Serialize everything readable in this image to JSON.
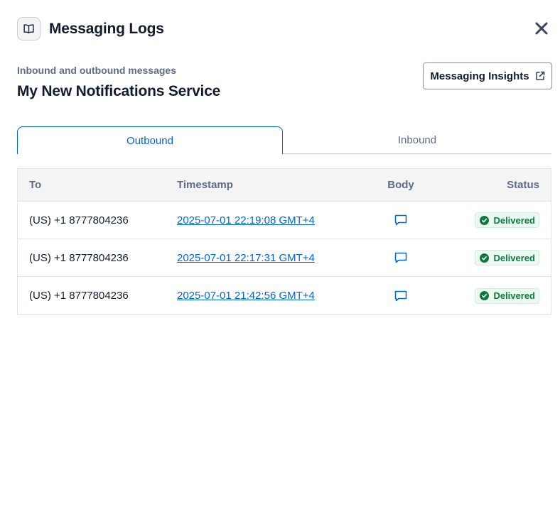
{
  "header": {
    "title": "Messaging Logs",
    "icon": "book-open-icon"
  },
  "close": {
    "icon": "close-icon"
  },
  "subtitle": "Inbound and outbound messages",
  "service_name": "My New Notifications Service",
  "insights_button": {
    "label": "Messaging Insights",
    "icon": "external-link-icon"
  },
  "tabs": [
    {
      "label": "Outbound",
      "selected": true
    },
    {
      "label": "Inbound",
      "selected": false
    }
  ],
  "table": {
    "columns": [
      "To",
      "Timestamp",
      "Body",
      "Status"
    ],
    "rows": [
      {
        "to": "(US) +1 8777804236",
        "timestamp": "2025-07-01 22:19:08 GMT+4",
        "body_icon": "chat-icon",
        "status": "Delivered"
      },
      {
        "to": "(US) +1 8777804236",
        "timestamp": "2025-07-01 22:17:31 GMT+4",
        "body_icon": "chat-icon",
        "status": "Delivered"
      },
      {
        "to": "(US) +1 8777804236",
        "timestamp": "2025-07-01 21:42:56 GMT+4",
        "body_icon": "chat-icon",
        "status": "Delivered"
      }
    ]
  },
  "colors": {
    "accent": "#0263e0",
    "success": "#0c7a3d",
    "success_bg": "#ebf9f1",
    "text": "#121c2d",
    "muted": "#606b85"
  }
}
